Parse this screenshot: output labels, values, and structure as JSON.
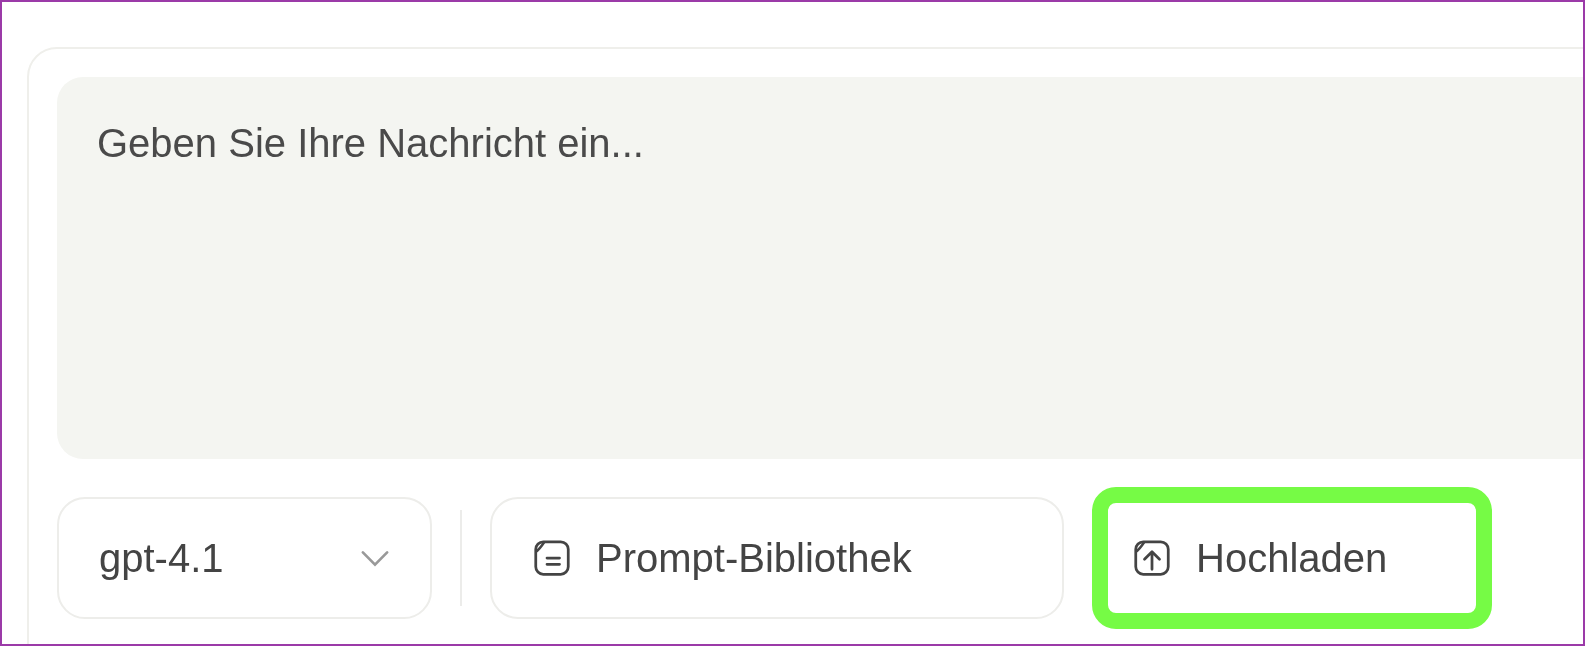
{
  "message_input": {
    "placeholder": "Geben Sie Ihre Nachricht ein..."
  },
  "model_select": {
    "value": "gpt-4.1"
  },
  "buttons": [
    {
      "kind": "library",
      "label": "Prompt-Bibliothek",
      "highlighted": false
    },
    {
      "kind": "upload",
      "label": "Hochladen",
      "highlighted": true
    }
  ]
}
